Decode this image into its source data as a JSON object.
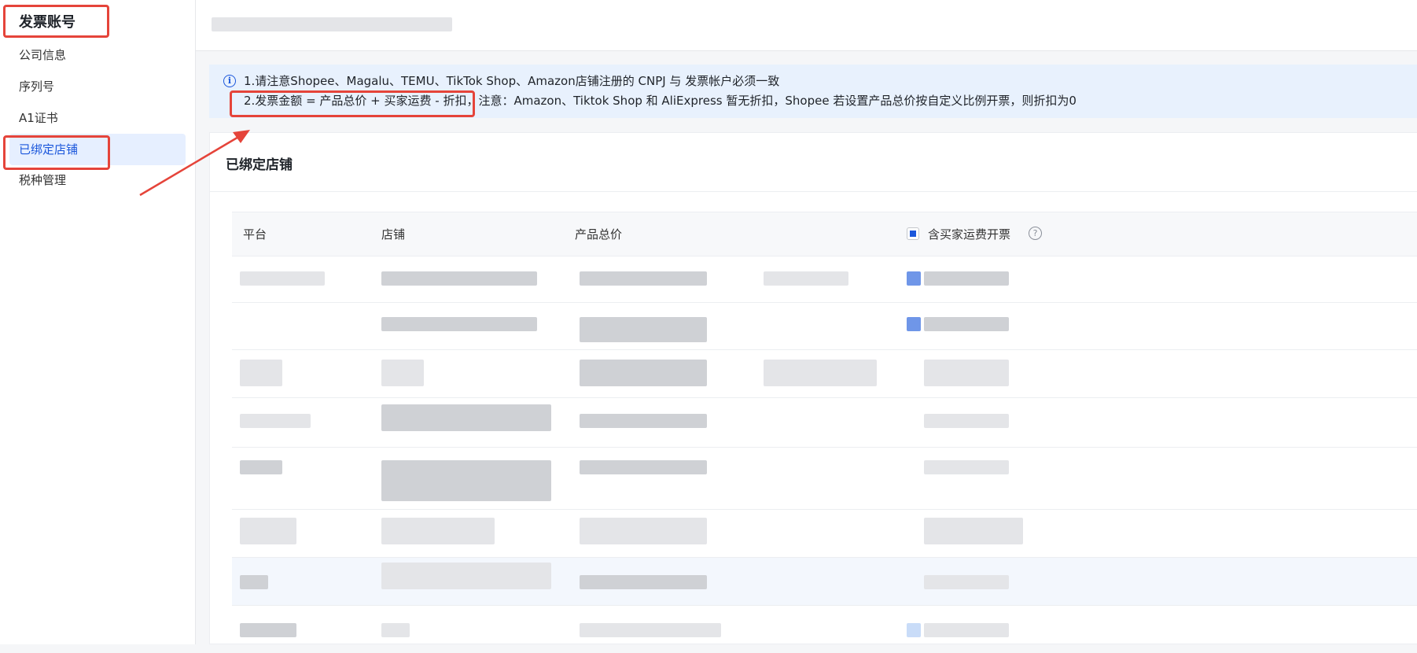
{
  "sidebar": {
    "title": "发票账号",
    "items": [
      {
        "label": "公司信息"
      },
      {
        "label": "序列号"
      },
      {
        "label": "A1证书"
      },
      {
        "label": "已绑定店铺"
      },
      {
        "label": "税种管理"
      }
    ]
  },
  "notice": {
    "line1": "1.请注意Shopee、Magalu、TEMU、TikTok Shop、Amazon店铺注册的 CNPJ 与 发票帐户必须一致",
    "line2": "2.发票金额 = 产品总价 + 买家运费 - 折扣，注意：Amazon、Tiktok Shop 和 AliExpress 暂无折扣，Shopee 若设置产品总价按自定义比例开票，则折扣为0"
  },
  "card": {
    "title": "已绑定店铺"
  },
  "table": {
    "columns": [
      "平台",
      "店铺",
      "产品总价",
      "含买家运费开票"
    ],
    "help_icon": "?"
  },
  "colors": {
    "accent": "#1a56db",
    "annotation": "#e5443a",
    "active_bg": "#e6efff",
    "notice_bg": "#e8f1fd"
  }
}
